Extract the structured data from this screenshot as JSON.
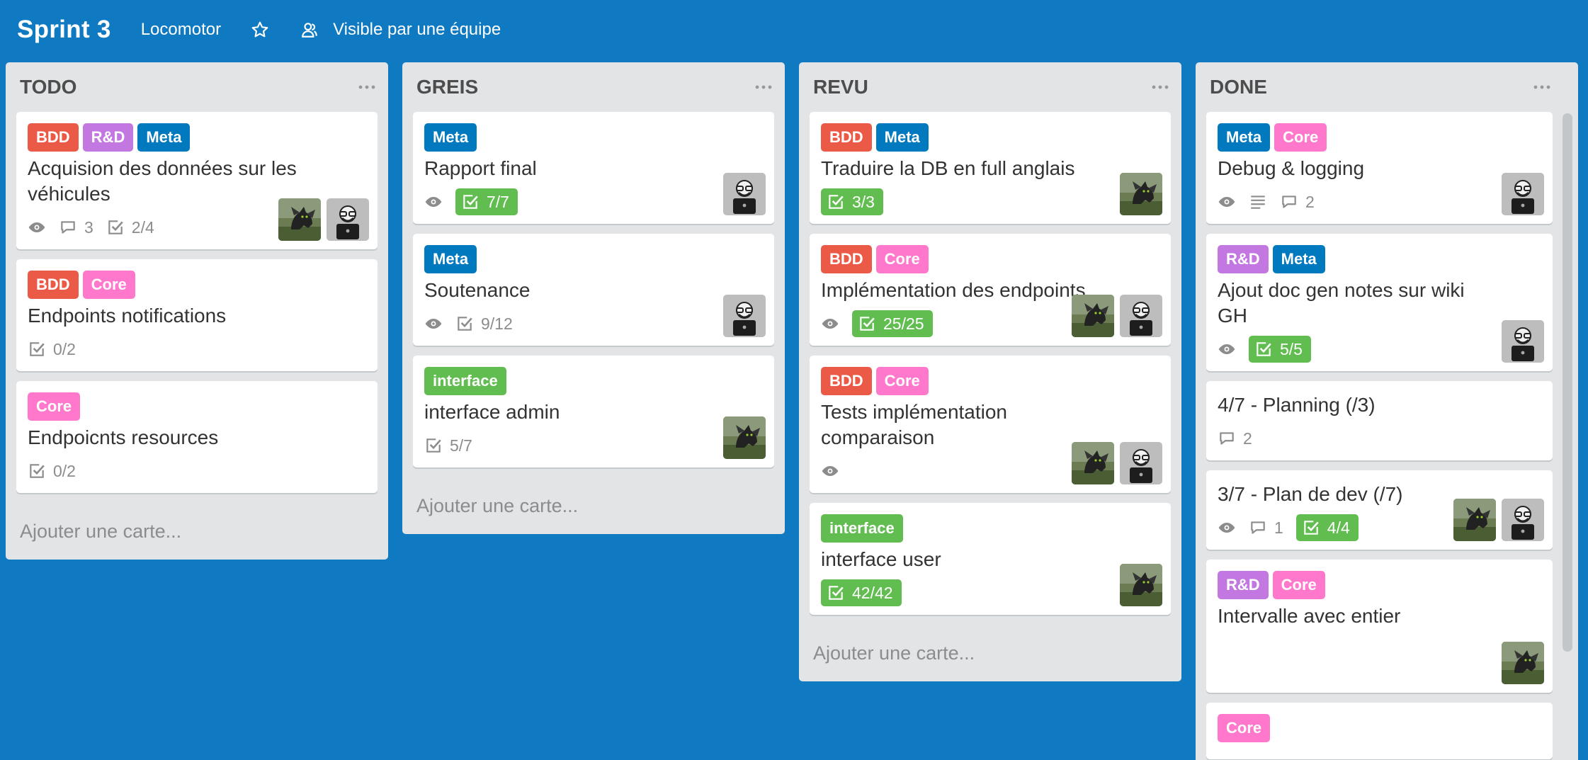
{
  "header": {
    "title": "Sprint 3",
    "org": "Locomotor",
    "visibility": "Visible par une équipe"
  },
  "colors": {
    "background": "#0f7ac2",
    "BDD": "#eb5a46",
    "R&D": "#c377e0",
    "Meta": "#0079bf",
    "Core": "#ff78cb",
    "interface": "#61bd4f",
    "done_badge": "#61bd4f"
  },
  "add_card_label": "Ajouter une carte...",
  "lists": [
    {
      "title": "TODO",
      "cards": [
        {
          "labels": [
            "BDD",
            "R&D",
            "Meta"
          ],
          "title": "Acquision des données sur les véhicules",
          "badges": [
            {
              "type": "watch"
            },
            {
              "type": "comments",
              "value": "3"
            },
            {
              "type": "checklist",
              "value": "2/4"
            }
          ],
          "members": [
            "dragon",
            "hacker"
          ]
        },
        {
          "labels": [
            "BDD",
            "Core"
          ],
          "title": "Endpoints notifications",
          "badges": [
            {
              "type": "checklist",
              "value": "0/2"
            }
          ],
          "members": []
        },
        {
          "labels": [
            "Core"
          ],
          "title": "Endpoicnts resources",
          "badges": [
            {
              "type": "checklist",
              "value": "0/2"
            }
          ],
          "members": []
        }
      ]
    },
    {
      "title": "GREIS",
      "cards": [
        {
          "labels": [
            "Meta"
          ],
          "title": "Rapport final",
          "badges": [
            {
              "type": "watch"
            },
            {
              "type": "checklist-done",
              "value": "7/7"
            }
          ],
          "members": [
            "hacker"
          ]
        },
        {
          "labels": [
            "Meta"
          ],
          "title": "Soutenance",
          "badges": [
            {
              "type": "watch"
            },
            {
              "type": "checklist",
              "value": "9/12"
            }
          ],
          "members": [
            "hacker"
          ]
        },
        {
          "labels": [
            "interface"
          ],
          "title": "interface admin",
          "badges": [
            {
              "type": "checklist",
              "value": "5/7"
            }
          ],
          "members": [
            "dragon"
          ]
        }
      ]
    },
    {
      "title": "REVU",
      "cards": [
        {
          "labels": [
            "BDD",
            "Meta"
          ],
          "title": "Traduire la DB en full anglais",
          "badges": [
            {
              "type": "checklist-done",
              "value": "3/3"
            }
          ],
          "members": [
            "dragon"
          ]
        },
        {
          "labels": [
            "BDD",
            "Core"
          ],
          "title": "Implémentation des endpoints",
          "badges": [
            {
              "type": "watch"
            },
            {
              "type": "checklist-done",
              "value": "25/25"
            }
          ],
          "members": [
            "dragon",
            "hacker"
          ]
        },
        {
          "labels": [
            "BDD",
            "Core"
          ],
          "title": "Tests implémentation comparaison",
          "badges": [
            {
              "type": "watch"
            }
          ],
          "members": [
            "dragon",
            "hacker"
          ]
        },
        {
          "labels": [
            "interface"
          ],
          "title": "interface user",
          "badges": [
            {
              "type": "checklist-done",
              "value": "42/42"
            }
          ],
          "members": [
            "dragon"
          ]
        }
      ]
    },
    {
      "title": "DONE",
      "cards": [
        {
          "labels": [
            "Meta",
            "Core"
          ],
          "title": "Debug & logging",
          "badges": [
            {
              "type": "watch"
            },
            {
              "type": "description"
            },
            {
              "type": "comments",
              "value": "2"
            }
          ],
          "members": [
            "hacker"
          ]
        },
        {
          "labels": [
            "R&D",
            "Meta"
          ],
          "title": "Ajout doc gen notes sur wiki GH",
          "badges": [
            {
              "type": "watch"
            },
            {
              "type": "checklist-done",
              "value": "5/5"
            }
          ],
          "members": [
            "hacker"
          ]
        },
        {
          "labels": [],
          "title": "4/7 - Planning (/3)",
          "badges": [
            {
              "type": "comments",
              "value": "2"
            }
          ],
          "members": []
        },
        {
          "labels": [],
          "title": "3/7 - Plan de dev (/7)",
          "badges": [
            {
              "type": "watch"
            },
            {
              "type": "comments",
              "value": "1"
            },
            {
              "type": "checklist-done",
              "value": "4/4"
            }
          ],
          "members": [
            "dragon",
            "hacker"
          ]
        },
        {
          "labels": [
            "R&D",
            "Core"
          ],
          "title": "Intervalle avec entier",
          "badges": [],
          "members": [
            "dragon"
          ]
        },
        {
          "labels": [
            "Core"
          ],
          "title": "",
          "badges": [],
          "members": []
        }
      ]
    }
  ]
}
